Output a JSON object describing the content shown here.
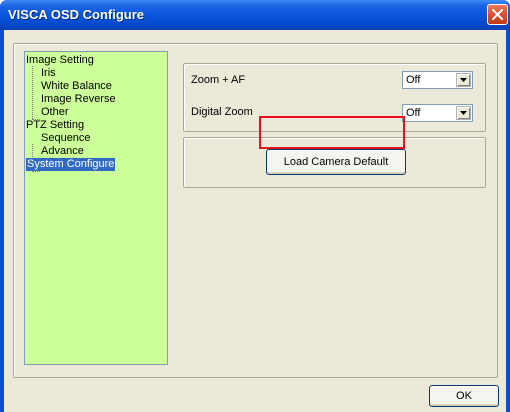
{
  "window": {
    "title": "VISCA OSD Configure"
  },
  "tree": {
    "items": [
      {
        "label": "Image Setting",
        "level": 0
      },
      {
        "label": "Iris",
        "level": 1
      },
      {
        "label": "White Balance",
        "level": 1
      },
      {
        "label": "Image Reverse",
        "level": 1
      },
      {
        "label": "Other",
        "level": 1
      },
      {
        "label": "PTZ Setting",
        "level": 0
      },
      {
        "label": "Sequence",
        "level": 1
      },
      {
        "label": "Advance",
        "level": 1
      },
      {
        "label": "System Configure",
        "level": 0,
        "selected": true
      }
    ]
  },
  "settings": {
    "zoom_af": {
      "label": "Zoom + AF",
      "value": "Off"
    },
    "digital_zoom": {
      "label": "Digital Zoom",
      "value": "Off"
    }
  },
  "buttons": {
    "load_default": "Load Camera Default",
    "ok": "OK"
  },
  "colors": {
    "title_bar": "#0a55dc",
    "tree_background": "#ccff99",
    "selection": "#316ac5",
    "highlight": "#e8101a",
    "dialog_face": "#ece9d8"
  }
}
